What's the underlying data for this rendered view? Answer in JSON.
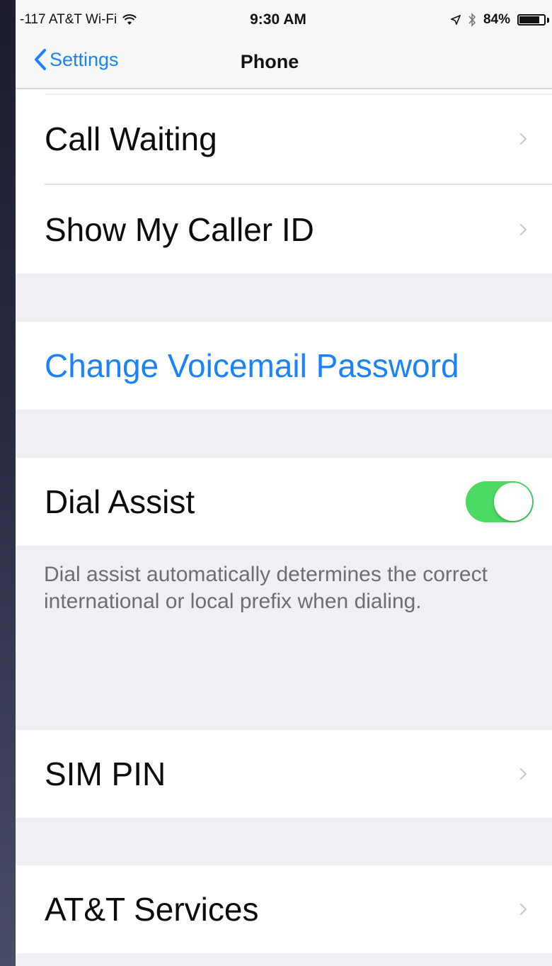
{
  "status_bar": {
    "carrier": "-117 AT&T Wi-Fi",
    "time": "9:30 AM",
    "battery_percent": "84%",
    "battery_level": 0.84
  },
  "nav": {
    "back_label": "Settings",
    "title": "Phone"
  },
  "rows": {
    "call_waiting": "Call Waiting",
    "caller_id": "Show My Caller ID",
    "voicemail_password": "Change Voicemail Password",
    "dial_assist": "Dial Assist",
    "dial_assist_on": true,
    "dial_assist_footer": "Dial assist automatically determines the correct international or local prefix when dialing.",
    "sim_pin": "SIM PIN",
    "att_services": "AT&T Services"
  },
  "colors": {
    "accent": "#1a82fb",
    "toggle_on": "#4cd964",
    "grouped_background": "#efeff4"
  }
}
